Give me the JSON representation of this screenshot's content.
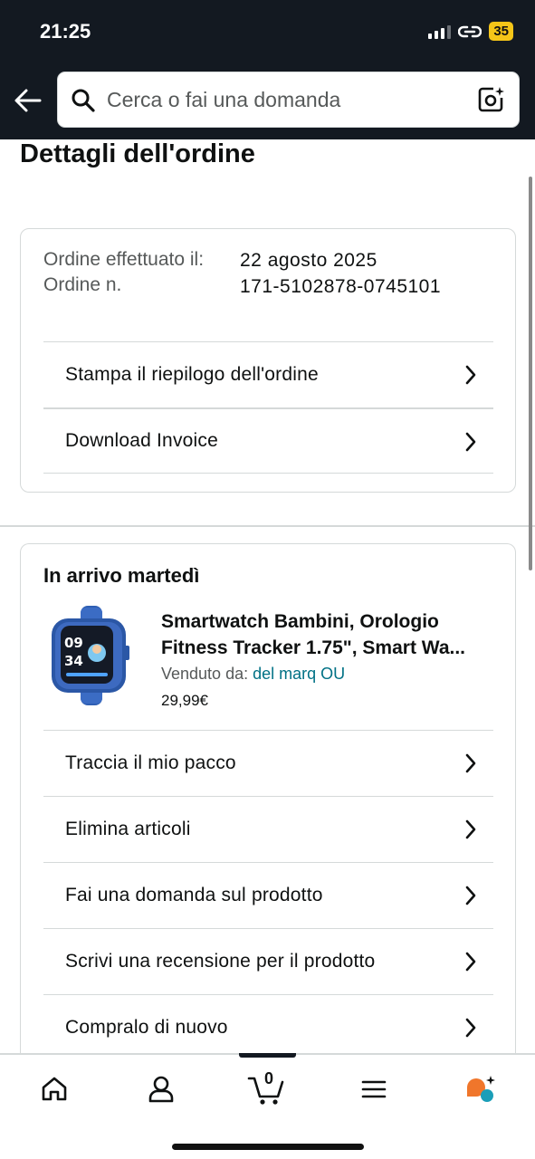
{
  "status_bar": {
    "time": "21:25",
    "battery": "35"
  },
  "search": {
    "placeholder": "Cerca o fai una domanda"
  },
  "page_title": "Dettagli dell'ordine",
  "order_info": {
    "placed_label": "Ordine effettuato il:",
    "number_label": "Ordine n.",
    "placed_value": "22 agosto 2025",
    "number_value": "171-5102878-0745101",
    "actions": [
      "Stampa il riepilogo dell'ordine",
      "Download Invoice"
    ]
  },
  "shipment": {
    "heading": "In arrivo martedì",
    "product_title": "Smartwatch Bambini, Orologio Fitness Tracker 1.75\", Smart Wa...",
    "sold_by_label": "Venduto da:",
    "seller_name": "del marq OU",
    "price": "29,99€",
    "actions": [
      "Traccia il mio pacco",
      "Elimina articoli",
      "Fai una domanda sul prodotto",
      "Scrivi una recensione per il prodotto",
      "Compralo di nuovo"
    ]
  },
  "bottom_nav": {
    "cart_count": "0"
  },
  "icons": [
    "back-arrow-icon",
    "search-icon",
    "camera-lens-icon",
    "chevron-right-icon",
    "home-icon",
    "account-icon",
    "cart-icon",
    "menu-icon",
    "rufus-icon"
  ],
  "colors": {
    "header_bg": "#131921",
    "link": "#007185",
    "battery": "#f5c518"
  }
}
